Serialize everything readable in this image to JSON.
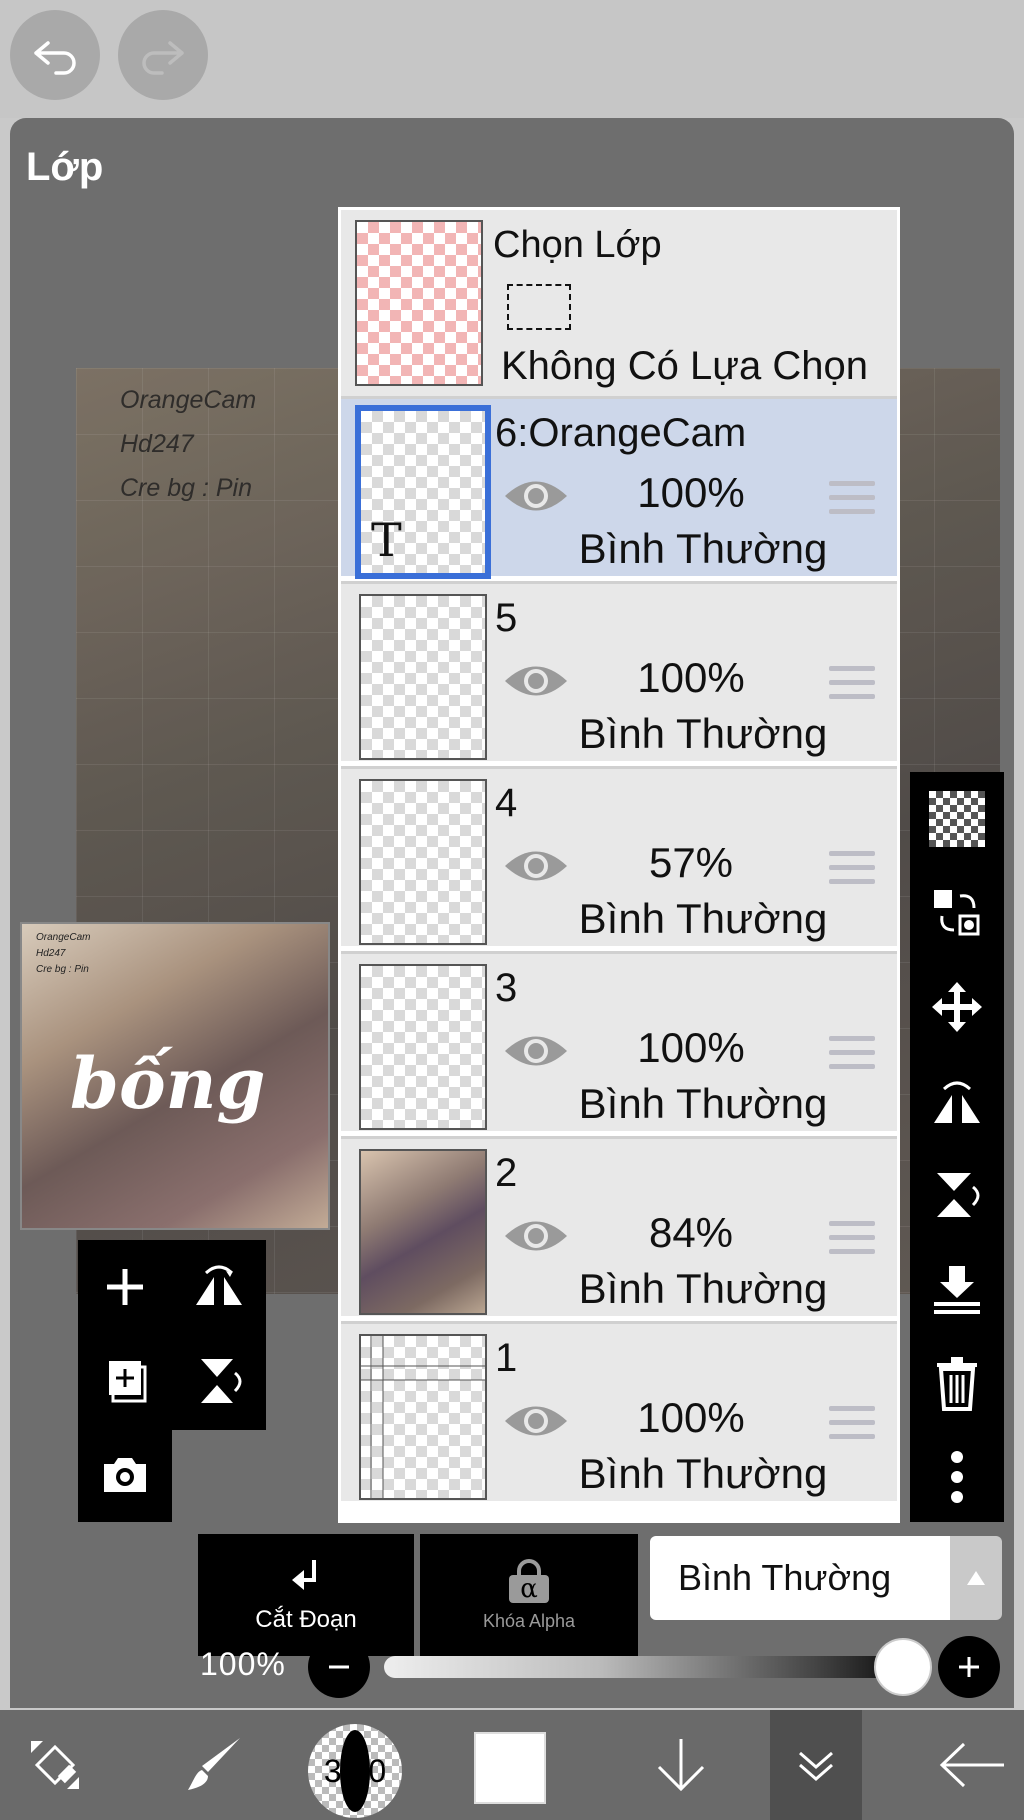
{
  "topbar": {
    "undo_icon": "undo-icon",
    "redo_icon": "redo-icon"
  },
  "panel": {
    "title": "Lớp"
  },
  "canvas": {
    "lines": [
      "OrangeCam",
      "Hd247",
      "Cre bg : Pin"
    ]
  },
  "preview": {
    "lines": [
      "OrangeCam",
      "Hd247",
      "Cre bg : Pin"
    ],
    "word": "bống"
  },
  "selection": {
    "title": "Chọn Lớp",
    "status": "Không Có Lựa Chọn"
  },
  "layers": [
    {
      "name": "6:OrangeCam",
      "opacity": "100%",
      "mode": "Bình Thường",
      "active": true,
      "thumb_glyph": "T"
    },
    {
      "name": "5",
      "opacity": "100%",
      "mode": "Bình Thường"
    },
    {
      "name": "4",
      "opacity": "57%",
      "mode": "Bình Thường"
    },
    {
      "name": "3",
      "opacity": "100%",
      "mode": "Bình Thường"
    },
    {
      "name": "2",
      "opacity": "84%",
      "mode": "Bình Thường"
    },
    {
      "name": "1",
      "opacity": "100%",
      "mode": "Bình Thường"
    }
  ],
  "bottom": {
    "clip_label": "Cắt Đoạn",
    "alpha_label": "Khóa Alpha",
    "alpha_glyph": "α",
    "blend_mode": "Bình Thường"
  },
  "opacity_slider": {
    "label": "100%",
    "value": 1.0
  },
  "toolbar": {
    "brush_size": "30.0",
    "color": "#ffffff"
  },
  "colors": {
    "active_layer_bg": "#cdd7ea",
    "active_border": "#3a6fd8",
    "panel_bg": "#6e6e6e"
  }
}
